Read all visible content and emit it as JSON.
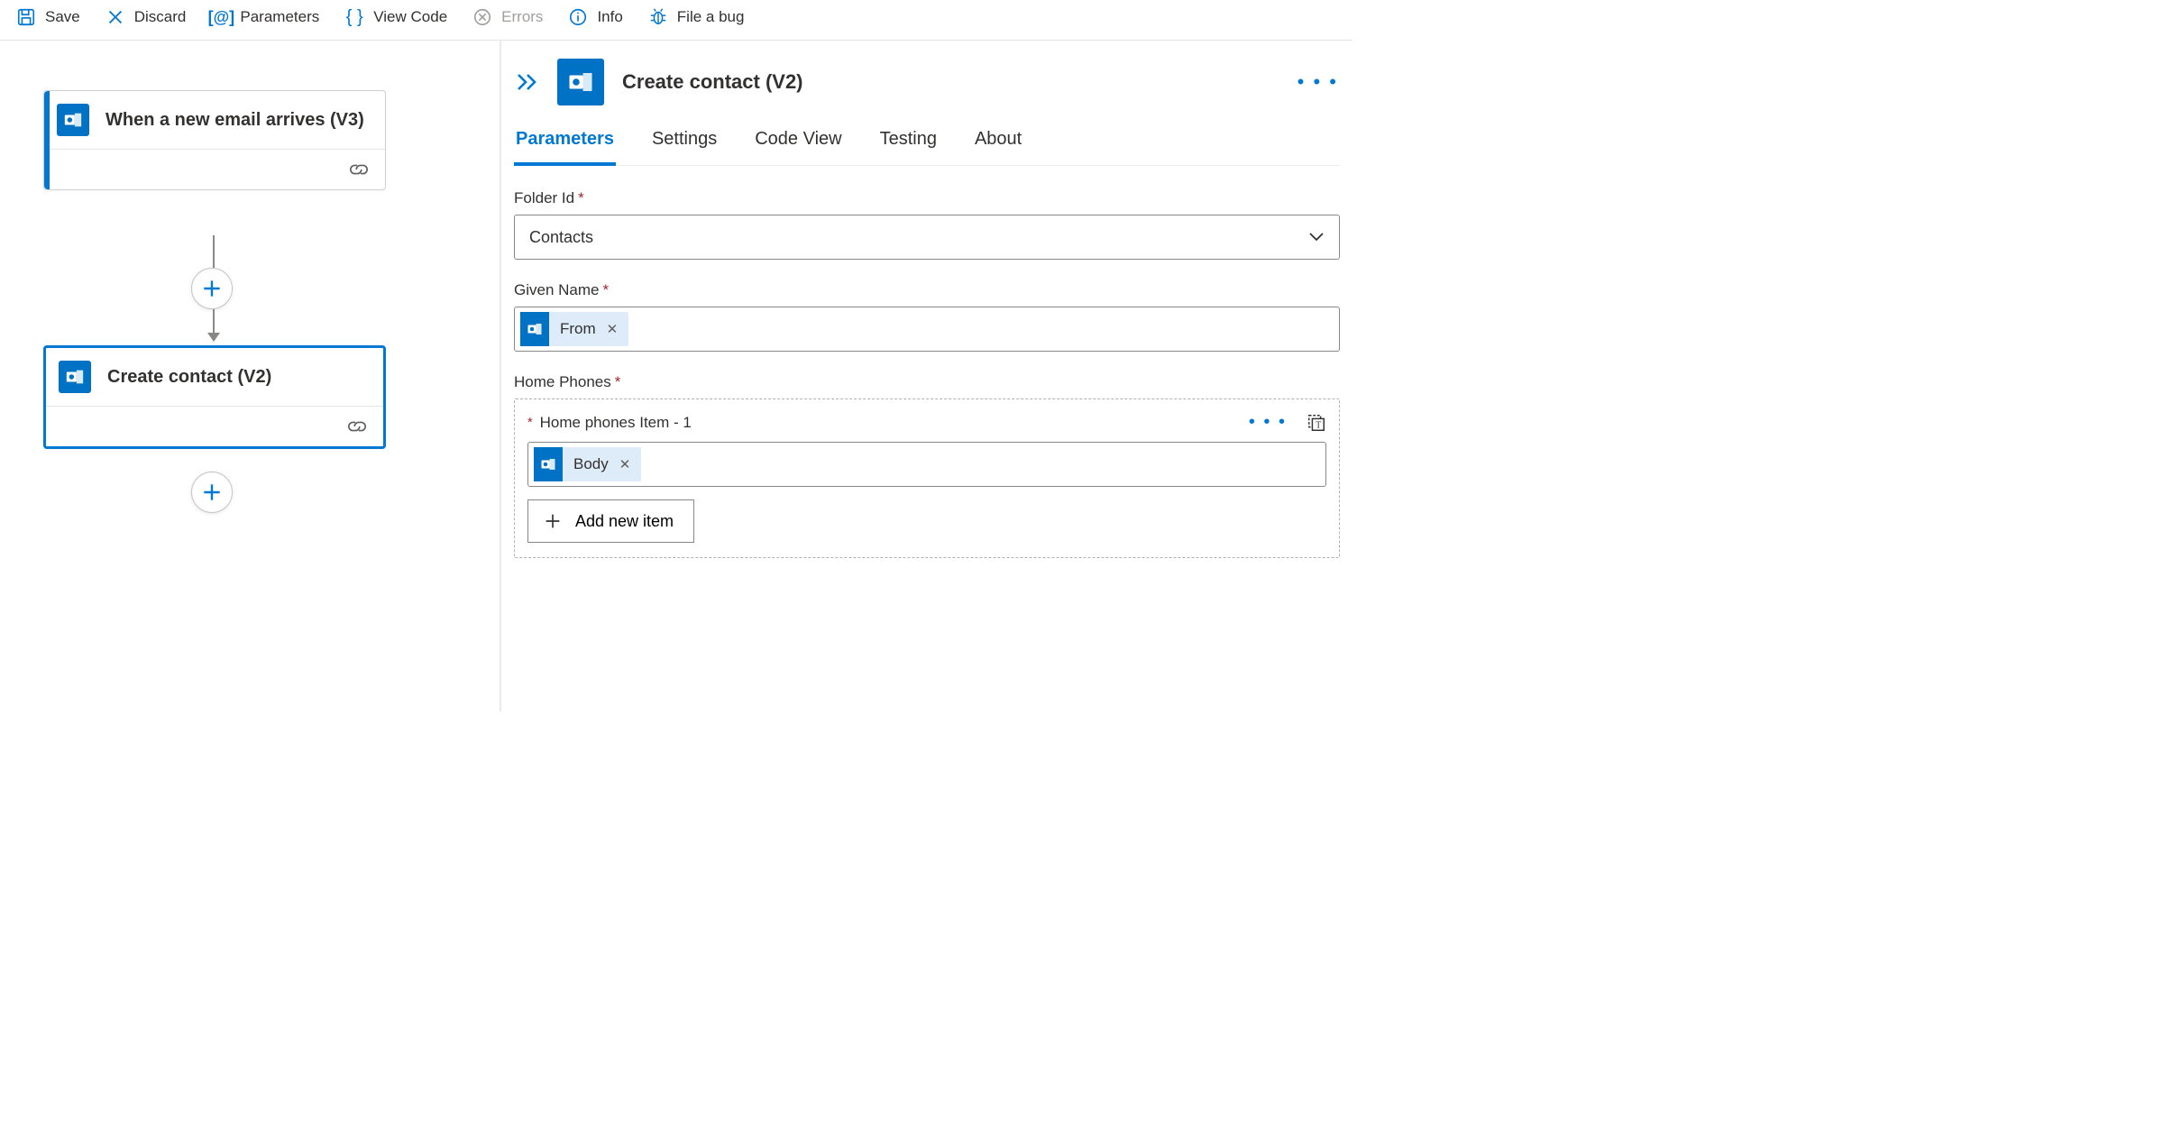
{
  "toolbar": {
    "save": "Save",
    "discard": "Discard",
    "parameters": "Parameters",
    "view_code": "View Code",
    "errors": "Errors",
    "info": "Info",
    "file_bug": "File a bug"
  },
  "flow": {
    "trigger_title": "When a new email arrives (V3)",
    "action_title": "Create contact (V2)"
  },
  "panel": {
    "title": "Create contact (V2)",
    "tabs": {
      "parameters": "Parameters",
      "settings": "Settings",
      "code_view": "Code View",
      "testing": "Testing",
      "about": "About"
    },
    "fields": {
      "folder_id_label": "Folder Id",
      "folder_id_value": "Contacts",
      "given_name_label": "Given Name",
      "given_name_token": "From",
      "home_phones_label": "Home Phones",
      "home_phones_item_label": "Home phones Item - 1",
      "home_phones_item_token": "Body",
      "add_new_item": "Add new item"
    }
  }
}
